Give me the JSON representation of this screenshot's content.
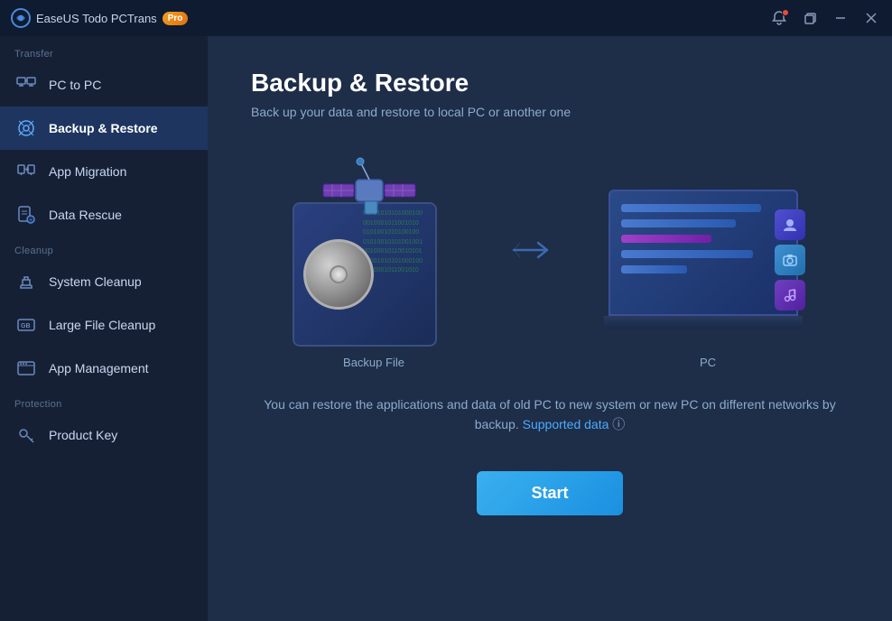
{
  "titlebar": {
    "app_name": "EaseUS Todo PCTrans",
    "pro_badge": "Pro",
    "logo_symbol": "⊕"
  },
  "sidebar": {
    "section_transfer": "Transfer",
    "section_cleanup": "Cleanup",
    "section_protection": "Protection",
    "items": [
      {
        "id": "pc-to-pc",
        "label": "PC to PC",
        "active": false
      },
      {
        "id": "backup-restore",
        "label": "Backup & Restore",
        "active": true
      },
      {
        "id": "app-migration",
        "label": "App Migration",
        "active": false
      },
      {
        "id": "data-rescue",
        "label": "Data Rescue",
        "active": false
      },
      {
        "id": "system-cleanup",
        "label": "System Cleanup",
        "active": false
      },
      {
        "id": "large-file-cleanup",
        "label": "Large File Cleanup",
        "active": false
      },
      {
        "id": "app-management",
        "label": "App Management",
        "active": false
      },
      {
        "id": "product-key",
        "label": "Product Key",
        "active": false
      }
    ]
  },
  "content": {
    "title": "Backup & Restore",
    "subtitle": "Back up your data and restore to local PC or another one",
    "backup_label": "Backup File",
    "pc_label": "PC",
    "info_text": "You can restore the applications and data of old PC to new system or new PC on different networks by backup.",
    "supported_data_link": "Supported data",
    "start_button": "Start",
    "data_stream_text": "01001010101000100\n0010001011001010\n0101001010100100\n01010010101001001"
  },
  "window_controls": {
    "minimize": "—",
    "restore": "❐",
    "close": "✕"
  },
  "colors": {
    "accent_blue": "#1a90e0",
    "sidebar_active": "#1e3560",
    "bg_dark": "#162035",
    "bg_content": "#1e2d48"
  }
}
